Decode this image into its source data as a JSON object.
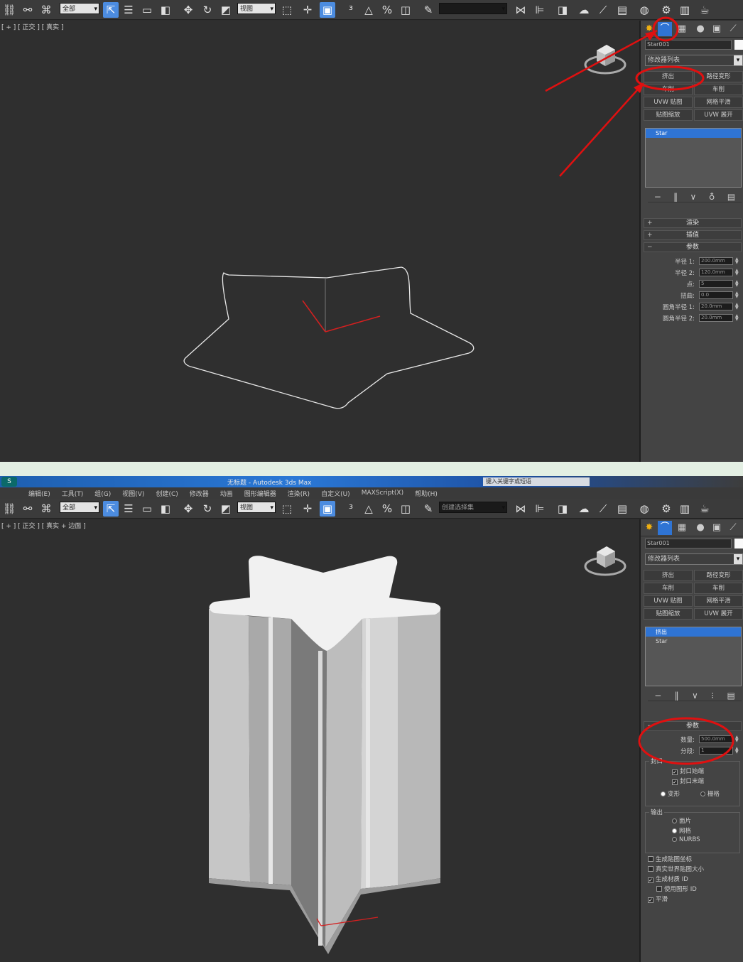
{
  "colors": {
    "viewport_bg": "#2f2f2f",
    "panel_bg": "#444444",
    "accent_blue": "#2f74d4",
    "annotation_red": "#e01010",
    "separator_green": "#e3efe3"
  },
  "shot1": {
    "toolbar": {
      "selection_filter": "全部",
      "view_dropdown": "视图",
      "named_selection": ""
    },
    "viewport_label": "[ + ] [ 正交 ] [ 真实 ]",
    "cmd": {
      "object_name": "Star001",
      "modifier_list": "修改器列表",
      "modifier_buttons": [
        "挤出",
        "路径变形",
        "车削",
        "车削",
        "UVW 贴图",
        "网格平滑",
        "贴图缩放",
        "UVW 展开"
      ],
      "stack_items": [
        "Star"
      ],
      "rollouts": [
        "渲染",
        "插值",
        "参数"
      ],
      "params": [
        {
          "label": "半径 1:",
          "value": "200.0mm"
        },
        {
          "label": "半径 2:",
          "value": "120.0mm"
        },
        {
          "label": "点:",
          "value": "5"
        },
        {
          "label": "扭曲:",
          "value": "0.0"
        },
        {
          "label": "圆角半径 1:",
          "value": "20.0mm"
        },
        {
          "label": "圆角半径 2:",
          "value": "20.0mm"
        }
      ]
    }
  },
  "shot2": {
    "titlebar": {
      "logo": "S",
      "title": "无标题 - Autodesk 3ds Max",
      "path": "键入关键字或短语"
    },
    "menu": [
      "编辑(E)",
      "工具(T)",
      "组(G)",
      "视图(V)",
      "创建(C)",
      "修改器",
      "动画",
      "图形编辑器",
      "渲染(R)",
      "自定义(U)",
      "MAXScript(X)",
      "帮助(H)"
    ],
    "toolbar": {
      "selection_filter": "全部",
      "view_dropdown": "视图",
      "named_selection": "创建选择集"
    },
    "viewport_label": "[ + ] [ 正交 ] [ 真实 + 边面 ]",
    "cmd": {
      "object_name": "Star001",
      "modifier_list": "修改器列表",
      "modifier_buttons": [
        "挤出",
        "路径变形",
        "车削",
        "车削",
        "UVW 贴图",
        "网格平滑",
        "贴图缩放",
        "UVW 展开"
      ],
      "stack_items": [
        "挤出",
        "Star"
      ],
      "rollout": "参数",
      "params": [
        {
          "label": "数量:",
          "value": "500.0mm"
        },
        {
          "label": "分段:",
          "value": "1"
        }
      ],
      "capping_label": "封口",
      "capping_options": [
        {
          "label": "封口始端",
          "checked": true
        },
        {
          "label": "封口末端",
          "checked": true
        }
      ],
      "cap_type": [
        {
          "label": "变形",
          "checked": true
        },
        {
          "label": "栅格",
          "checked": false
        }
      ],
      "output_label": "输出",
      "output_options": [
        {
          "label": "面片",
          "checked": false
        },
        {
          "label": "网格",
          "checked": true
        },
        {
          "label": "NURBS",
          "checked": false
        }
      ],
      "checkboxes": [
        {
          "label": "生成贴图坐标",
          "checked": false
        },
        {
          "label": "真实世界贴图大小",
          "checked": false
        },
        {
          "label": "生成材质 ID",
          "checked": true
        },
        {
          "label": "使用图形 ID",
          "checked": false
        },
        {
          "label": "平滑",
          "checked": true
        }
      ]
    }
  }
}
